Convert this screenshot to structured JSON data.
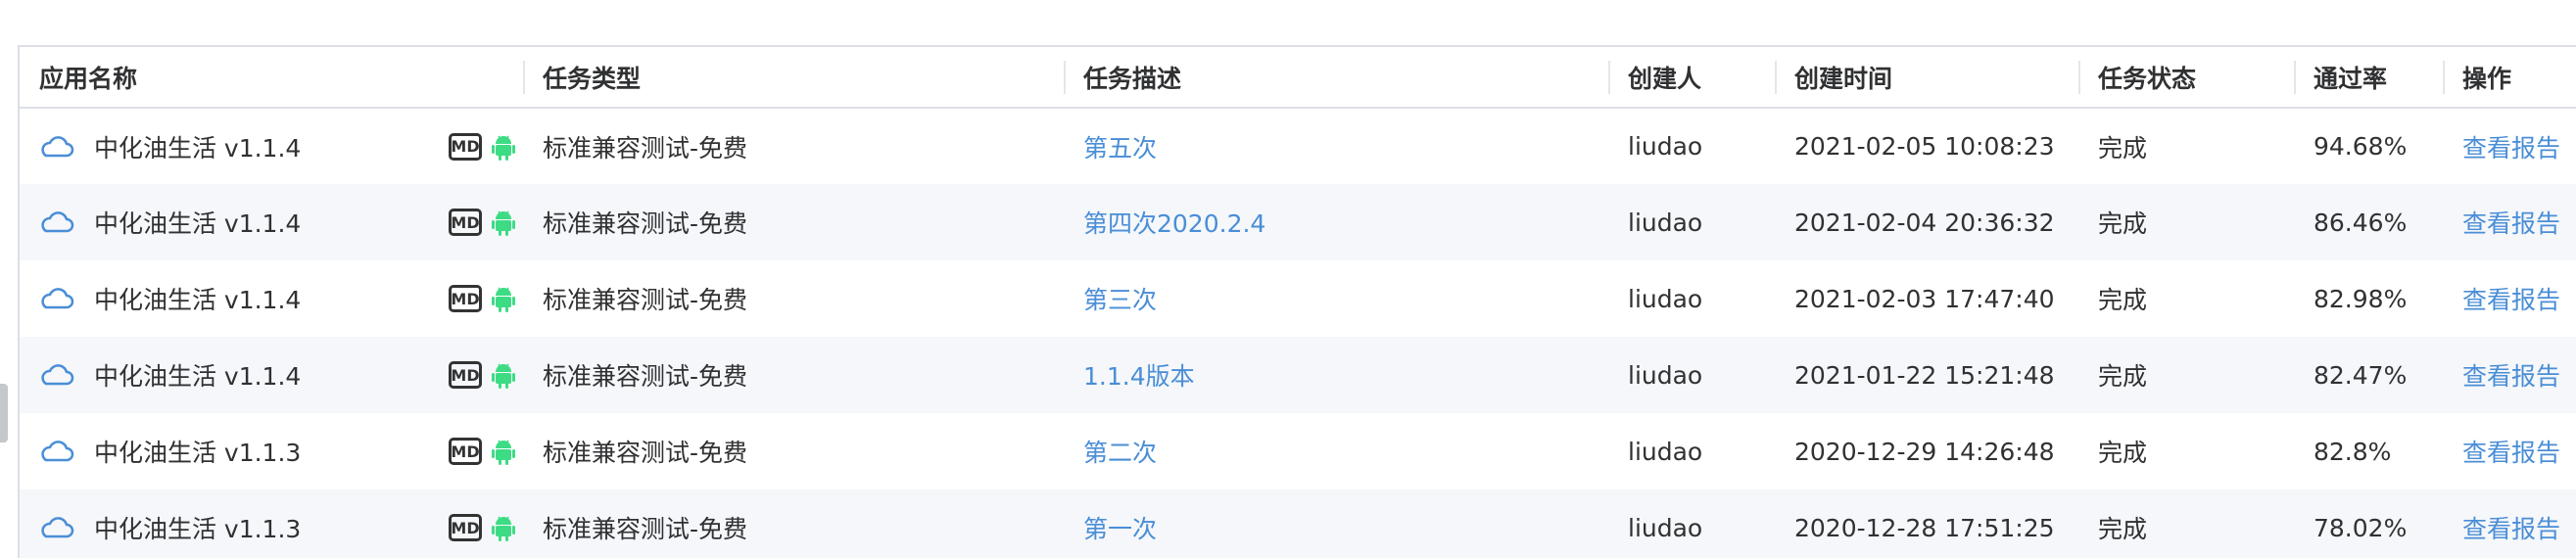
{
  "colors": {
    "link": "#4a8ed6",
    "android": "#3ddc84",
    "stripe": "#f5f7fa",
    "border": "#dcdfe6"
  },
  "table": {
    "headers": [
      "应用名称",
      "任务类型",
      "任务描述",
      "创建人",
      "创建时间",
      "任务状态",
      "通过率",
      "操作"
    ],
    "rows": [
      {
        "app": "中化油生活 v1.1.4",
        "badge": "MD",
        "type": "标准兼容测试-免费",
        "desc": "第五次",
        "creator": "liudao",
        "time": "2021-02-05 10:08:23",
        "status": "完成",
        "rate": "94.68%",
        "action": "查看报告"
      },
      {
        "app": "中化油生活 v1.1.4",
        "badge": "MD",
        "type": "标准兼容测试-免费",
        "desc": "第四次2020.2.4",
        "creator": "liudao",
        "time": "2021-02-04 20:36:32",
        "status": "完成",
        "rate": "86.46%",
        "action": "查看报告"
      },
      {
        "app": "中化油生活 v1.1.4",
        "badge": "MD",
        "type": "标准兼容测试-免费",
        "desc": "第三次",
        "creator": "liudao",
        "time": "2021-02-03 17:47:40",
        "status": "完成",
        "rate": "82.98%",
        "action": "查看报告"
      },
      {
        "app": "中化油生活 v1.1.4",
        "badge": "MD",
        "type": "标准兼容测试-免费",
        "desc": "1.1.4版本",
        "creator": "liudao",
        "time": "2021-01-22 15:21:48",
        "status": "完成",
        "rate": "82.47%",
        "action": "查看报告"
      },
      {
        "app": "中化油生活 v1.1.3",
        "badge": "MD",
        "type": "标准兼容测试-免费",
        "desc": "第二次",
        "creator": "liudao",
        "time": "2020-12-29 14:26:48",
        "status": "完成",
        "rate": "82.8%",
        "action": "查看报告"
      },
      {
        "app": "中化油生活 v1.1.3",
        "badge": "MD",
        "type": "标准兼容测试-免费",
        "desc": "第一次",
        "creator": "liudao",
        "time": "2020-12-28 17:51:25",
        "status": "完成",
        "rate": "78.02%",
        "action": "查看报告"
      }
    ]
  }
}
